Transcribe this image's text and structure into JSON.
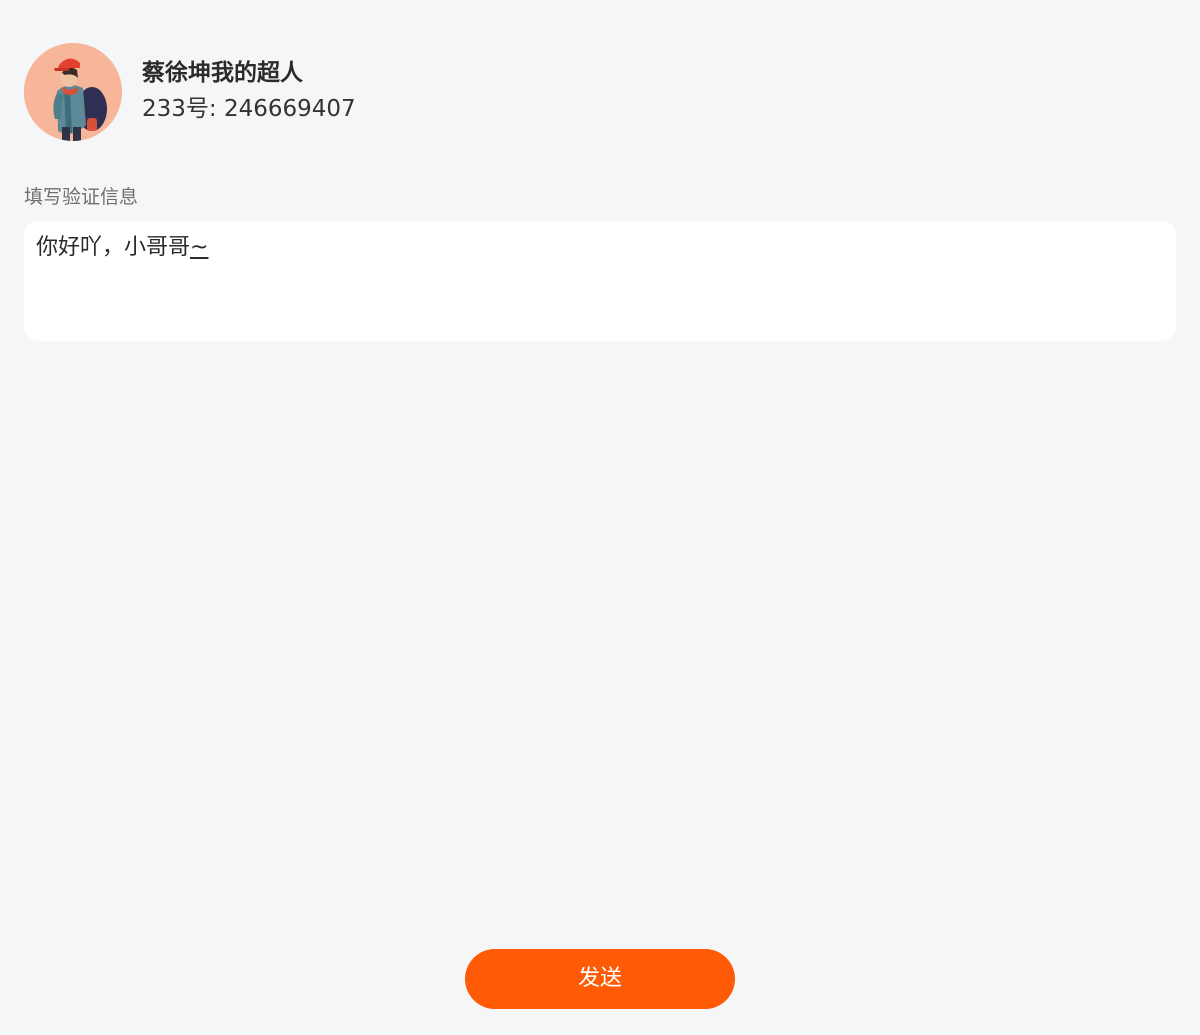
{
  "profile": {
    "avatar": "user-avatar-illustration",
    "name": "蔡徐坤我的超人",
    "id_text": "233号: 246669407"
  },
  "verification": {
    "label": "填写验证信息",
    "message_main": "你好吖，小哥哥",
    "message_tail": "~"
  },
  "actions": {
    "send_label": "发送"
  },
  "colors": {
    "background": "#f5f6f8",
    "accent": "#ff5a06",
    "text_primary": "#2b2b2b",
    "text_secondary": "#6f6f6f"
  }
}
